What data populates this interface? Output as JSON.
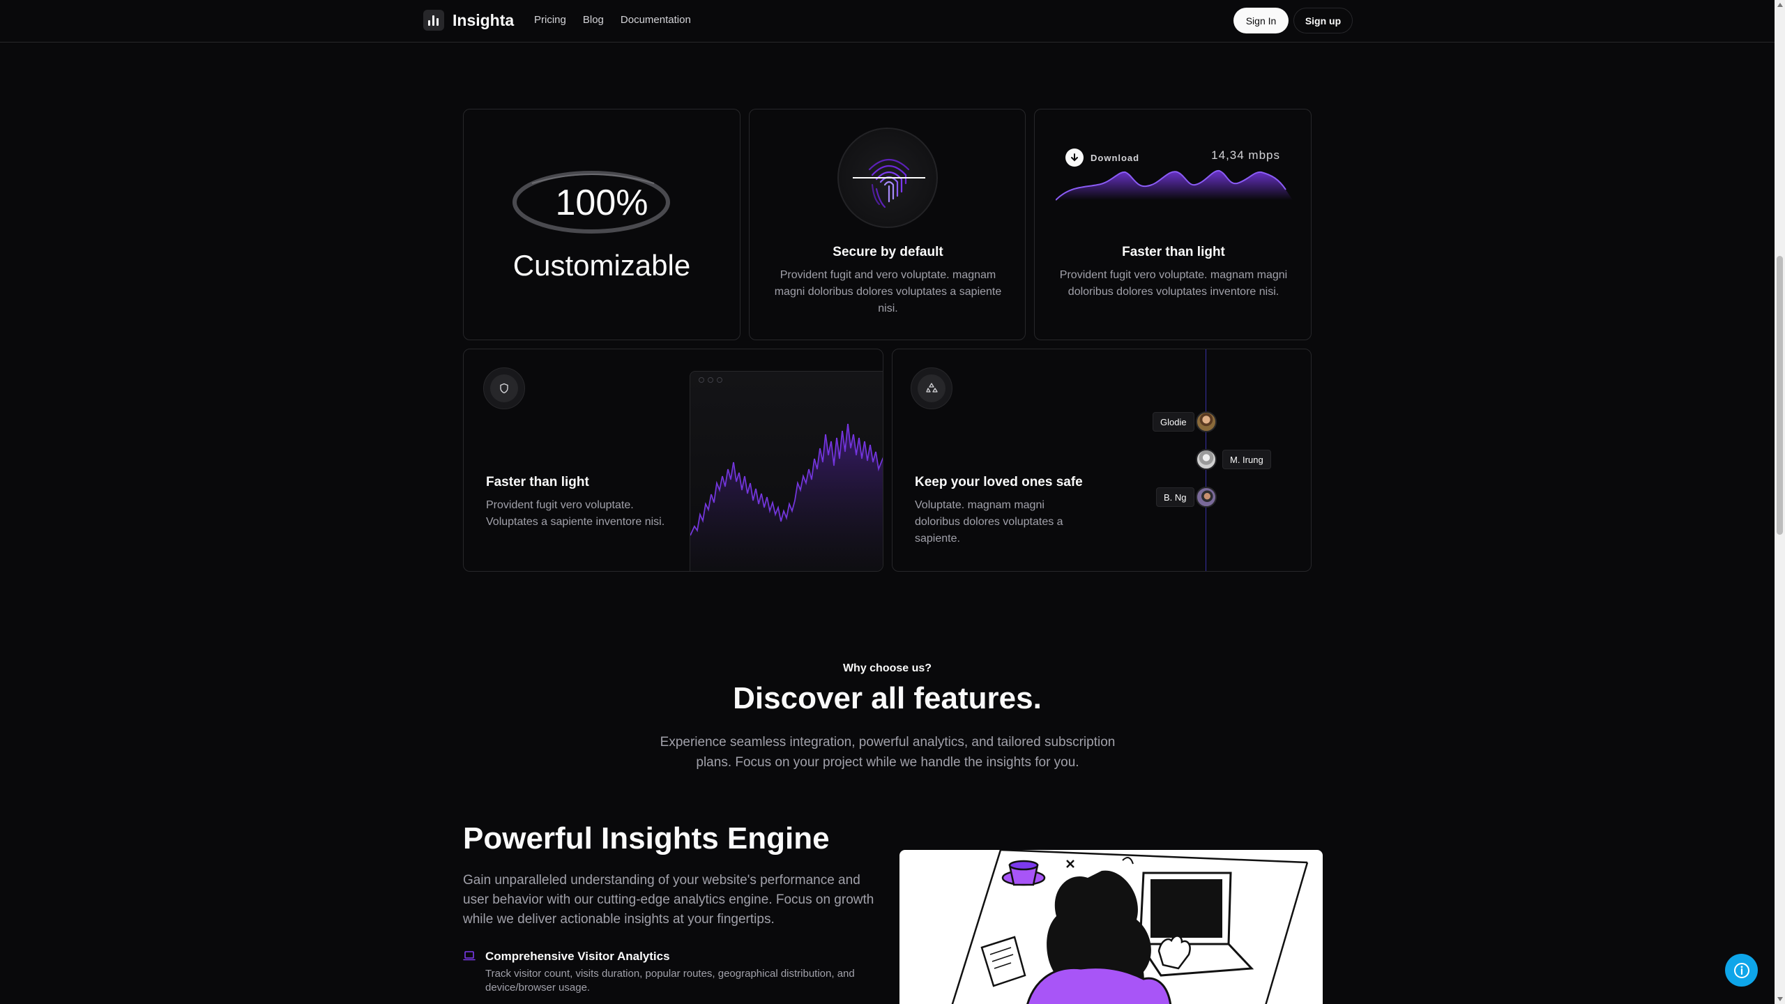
{
  "header": {
    "brand": "Insighta",
    "nav": [
      "Pricing",
      "Blog",
      "Documentation"
    ],
    "sign_in": "Sign In",
    "sign_up": "Sign up"
  },
  "cards": {
    "customizable": {
      "percent": "100%",
      "label": "Customizable"
    },
    "secure": {
      "title": "Secure by default",
      "desc": "Provident fugit and vero voluptate. magnam magni doloribus dolores voluptates a sapiente nisi."
    },
    "speed": {
      "download_label": "Download",
      "download_speed": "14,34 mbps",
      "title": "Faster than light",
      "desc": "Provident fugit vero voluptate. magnam magni doloribus dolores voluptates inventore nisi."
    },
    "chart_card": {
      "title": "Faster than light",
      "desc": "Provident fugit vero voluptate. Voluptates a sapiente inventore nisi."
    },
    "safe": {
      "title": "Keep your loved ones safe",
      "desc": "Voluptate. magnam magni doloribus dolores voluptates a sapiente.",
      "people": [
        "Glodie",
        "M. Irung",
        "B. Ng"
      ]
    }
  },
  "features": {
    "eyebrow": "Why choose us?",
    "heading": "Discover all features.",
    "intro": "Experience seamless integration, powerful analytics, and tailored subscription plans. Focus on your project while we handle the insights for you."
  },
  "engine": {
    "title": "Powerful Insights Engine",
    "desc": "Gain unparalleled understanding of your website's performance and user behavior with our cutting-edge analytics engine. Focus on growth while we deliver actionable insights at your fingertips.",
    "item_title": "Comprehensive Visitor Analytics",
    "item_desc": "Track visitor count, visits duration, popular routes, geographical distribution, and device/browser usage."
  },
  "colors": {
    "background": "#09090b",
    "border": "#27272a",
    "accent_purple": "#7c3aed",
    "help_button": "#0ea5e9"
  },
  "icons": [
    "logo-bars-icon",
    "download-arrow-icon",
    "fingerprint-icon",
    "shield-icon",
    "recycle-icon",
    "laptop-icon",
    "info-icon"
  ]
}
